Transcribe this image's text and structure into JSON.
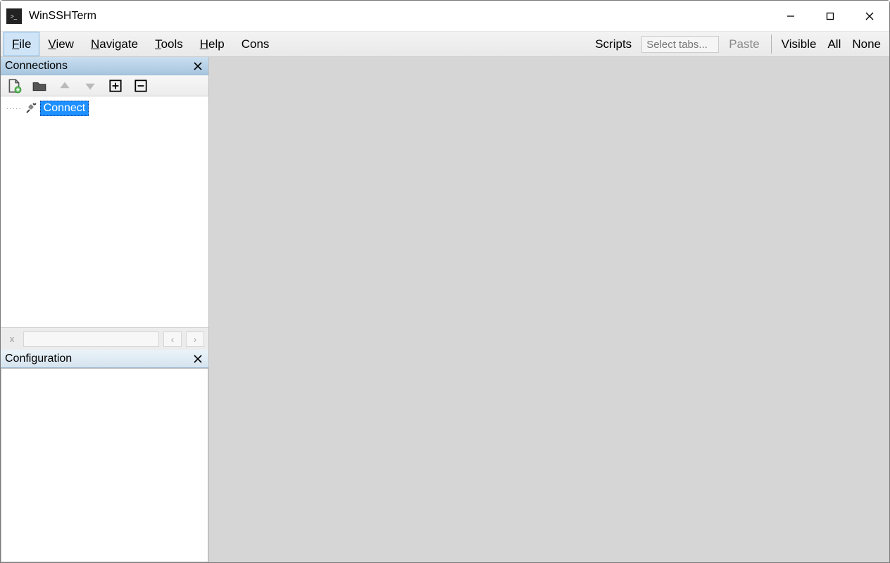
{
  "window": {
    "title": "WinSSHTerm"
  },
  "menu": {
    "file": "File",
    "view": "View",
    "navigate": "Navigate",
    "tools": "Tools",
    "help": "Help",
    "cons": "Cons"
  },
  "toolbar_right": {
    "scripts": "Scripts",
    "select_tabs_placeholder": "Select tabs...",
    "paste": "Paste",
    "visible": "Visible",
    "all": "All",
    "none": "None"
  },
  "panels": {
    "connections": "Connections",
    "configuration": "Configuration"
  },
  "tree": {
    "root_label": "Connect"
  },
  "search": {
    "x": "x",
    "prev": "‹",
    "next": "›",
    "value": ""
  }
}
